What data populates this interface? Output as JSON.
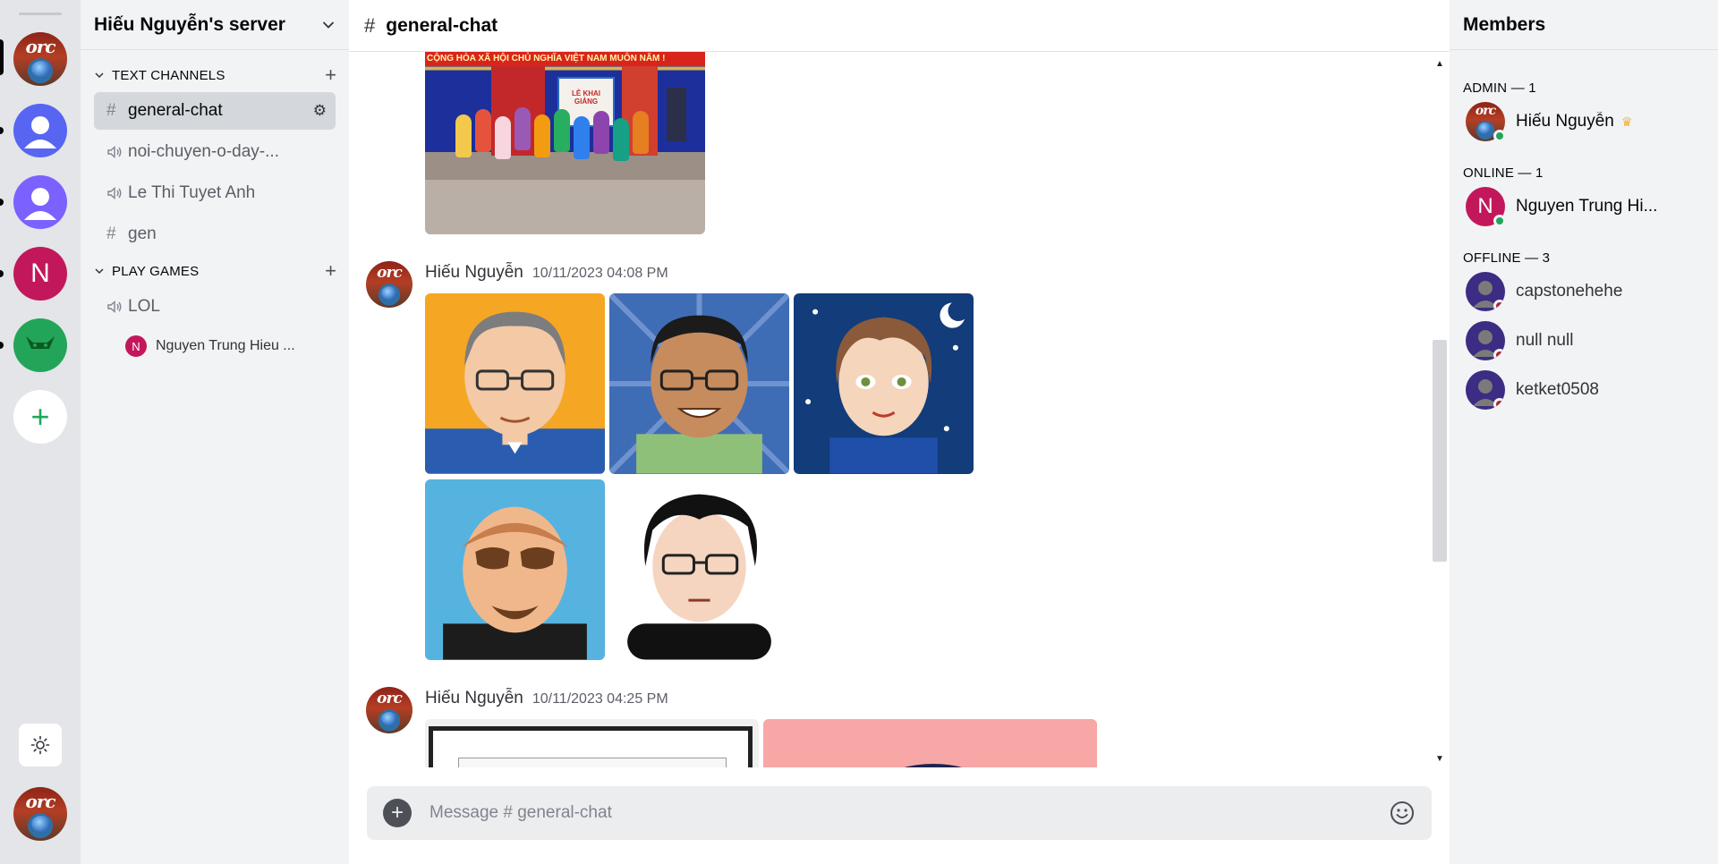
{
  "server": {
    "name": "Hiếu Nguyễn's server",
    "rail": {
      "letter_server": "N",
      "add_symbol": "+"
    }
  },
  "channels": {
    "categories": [
      {
        "label": "TEXT CHANNELS",
        "add": "+"
      },
      {
        "label": "PLAY GAMES",
        "add": "+"
      }
    ],
    "items": [
      {
        "name": "general-chat",
        "kind": "text",
        "active": true
      },
      {
        "name": "noi-chuyen-o-day-...",
        "kind": "voice"
      },
      {
        "name": "Le Thi Tuyet Anh",
        "kind": "voice"
      },
      {
        "name": "gen",
        "kind": "text"
      },
      {
        "name": "LOL",
        "kind": "voice"
      }
    ],
    "voice_user": {
      "initial": "N",
      "name": "Nguyen Trung Hieu ..."
    }
  },
  "chat": {
    "header_title": "general-chat",
    "messages": [
      {
        "author": "Hiếu Nguyễn",
        "time": "10/11/2023 04:08 PM"
      },
      {
        "author": "Hiếu Nguyễn",
        "time": "10/11/2023 04:25 PM"
      }
    ],
    "banner_text": "CỘNG HÒA XÃ HỘI CHỦ NGHĨA VIỆT NAM MUÔN NĂM !",
    "board_text": "LỄ KHAI GIẢNG",
    "input_placeholder": "Message # general-chat",
    "input_plus": "+"
  },
  "members": {
    "header": "Members",
    "groups": [
      {
        "label": "ADMIN — 1"
      },
      {
        "label": "ONLINE — 1"
      },
      {
        "label": "OFFLINE — 3"
      }
    ],
    "admin": {
      "name": "Hiếu Nguyễn"
    },
    "online": {
      "name": "Nguyen Trung Hi...",
      "initial": "N"
    },
    "offline": [
      {
        "name": "capstonehehe"
      },
      {
        "name": "null null"
      },
      {
        "name": "ketket0508"
      }
    ]
  },
  "colors": {
    "online_status": "#23a559",
    "offline_status": "#b2242b",
    "accent_pink": "#c2185b",
    "crown": "#f0b232"
  },
  "icons": [
    "hash-icon",
    "speaker-icon",
    "gear-icon",
    "chevron-down-icon",
    "plus-icon",
    "sun-icon",
    "smile-icon",
    "crown-icon"
  ]
}
